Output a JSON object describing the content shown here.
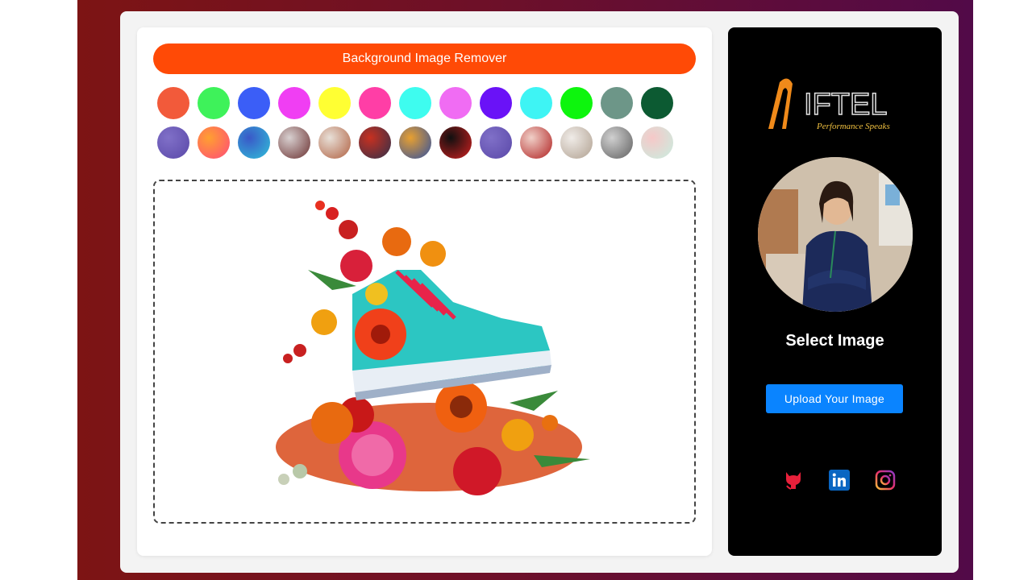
{
  "app": {
    "title": "Background Image Remover"
  },
  "swatches": {
    "solid_colors": [
      "#f25a3a",
      "#3ef25a",
      "#3b5ef7",
      "#f03ef3",
      "#ffff33",
      "#ff3ea6",
      "#3efcef",
      "#f06cf3",
      "#6a12f7",
      "#3ef4f4",
      "#0df50d",
      "#6d9688",
      "#0c5a32"
    ],
    "image_backgrounds": [
      {
        "name": "purple-marble",
        "c1": "#8070c8",
        "c2": "#5a48a8"
      },
      {
        "name": "orange-pink-gradient",
        "c1": "#ffa030",
        "c2": "#ff4a7a"
      },
      {
        "name": "blue-teal-gradient",
        "c1": "#3a58c8",
        "c2": "#30c0d8"
      },
      {
        "name": "swirl-abstract",
        "c1": "#d8d0d0",
        "c2": "#6a3030"
      },
      {
        "name": "floral-white",
        "c1": "#e8e0d8",
        "c2": "#b06040"
      },
      {
        "name": "colorful-ink",
        "c1": "#c83020",
        "c2": "#30304a"
      },
      {
        "name": "fluid-art",
        "c1": "#e8a030",
        "c2": "#3050a0"
      },
      {
        "name": "dark-red-drop",
        "c1": "#101010",
        "c2": "#d02020"
      },
      {
        "name": "purple-marble-2",
        "c1": "#8070c8",
        "c2": "#5a48a8"
      },
      {
        "name": "red-swirl",
        "c1": "#f0d0c8",
        "c2": "#b02020"
      },
      {
        "name": "white-room",
        "c1": "#f0ece8",
        "c2": "#b0a090"
      },
      {
        "name": "grey-bubbles",
        "c1": "#d0d0d0",
        "c2": "#606060"
      },
      {
        "name": "pastel-pink-teal",
        "c1": "#f6c8c8",
        "c2": "#c8eee0"
      }
    ]
  },
  "sidebar": {
    "logo_text": "IFTEL",
    "logo_tagline": "Performance Speaks",
    "select_title": "Select Image",
    "upload_label": "Upload Your Image",
    "socials": [
      "github-icon",
      "linkedin-icon",
      "instagram-icon"
    ]
  },
  "colors": {
    "accent": "#ff4a06",
    "upload": "#0a84ff"
  }
}
